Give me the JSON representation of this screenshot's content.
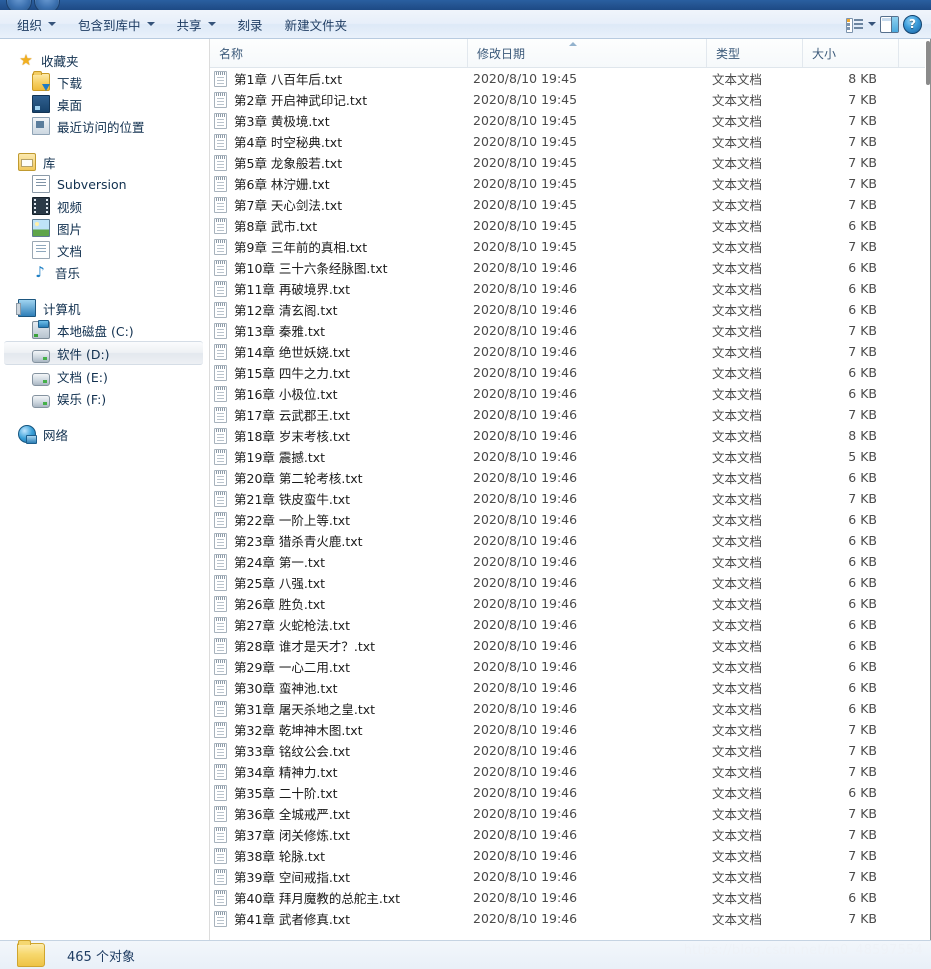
{
  "toolbar": {
    "items": [
      {
        "label": "组织",
        "caret": true,
        "name": "organize"
      },
      {
        "label": "包含到库中",
        "caret": true,
        "name": "include-in-library"
      },
      {
        "label": "共享",
        "caret": true,
        "name": "share-with"
      },
      {
        "label": "刻录",
        "caret": false,
        "name": "burn"
      },
      {
        "label": "新建文件夹",
        "caret": false,
        "name": "new-folder"
      }
    ],
    "right": {
      "views_icon": "views-icon",
      "views_caret_icon": "chevron-down-icon",
      "preview_pane_icon": "preview-pane-icon",
      "help_icon": "help-icon",
      "help_label": "?"
    }
  },
  "sidebar": {
    "groups": [
      {
        "header": {
          "label": "收藏夹",
          "icon": "star-icon",
          "name": "favorites"
        },
        "items": [
          {
            "label": "下载",
            "icon": "downloads-folder-icon",
            "name": "downloads"
          },
          {
            "label": "桌面",
            "icon": "desktop-icon",
            "name": "desktop"
          },
          {
            "label": "最近访问的位置",
            "icon": "recent-places-icon",
            "name": "recent-places"
          }
        ]
      },
      {
        "header": {
          "label": "库",
          "icon": "libraries-icon",
          "name": "libraries"
        },
        "items": [
          {
            "label": "Subversion",
            "icon": "document-icon",
            "name": "subversion"
          },
          {
            "label": "视频",
            "icon": "video-icon",
            "name": "videos"
          },
          {
            "label": "图片",
            "icon": "picture-icon",
            "name": "pictures"
          },
          {
            "label": "文档",
            "icon": "document-icon",
            "name": "documents"
          },
          {
            "label": "音乐",
            "icon": "music-note-icon",
            "name": "music"
          }
        ]
      },
      {
        "header": {
          "label": "计算机",
          "icon": "computer-icon",
          "name": "computer"
        },
        "items": [
          {
            "label": "本地磁盘 (C:)",
            "icon": "system-drive-icon",
            "name": "drive-c",
            "selected": false
          },
          {
            "label": "软件 (D:)",
            "icon": "drive-icon",
            "name": "drive-d",
            "selected": true
          },
          {
            "label": "文档 (E:)",
            "icon": "drive-icon",
            "name": "drive-e",
            "selected": false
          },
          {
            "label": "娱乐 (F:)",
            "icon": "drive-icon",
            "name": "drive-f",
            "selected": false
          }
        ]
      },
      {
        "header": {
          "label": "网络",
          "icon": "network-icon",
          "name": "network"
        },
        "items": []
      }
    ]
  },
  "columns": [
    {
      "label": "名称",
      "key": "name",
      "sorted": false
    },
    {
      "label": "修改日期",
      "key": "date",
      "sorted": true,
      "sort_direction": "asc"
    },
    {
      "label": "类型",
      "key": "type",
      "sorted": false
    },
    {
      "label": "大小",
      "key": "size",
      "sorted": false
    }
  ],
  "files": [
    {
      "name": "第1章 八百年后.txt",
      "date": "2020/8/10 19:45",
      "type": "文本文档",
      "size": "8 KB"
    },
    {
      "name": "第2章 开启神武印记.txt",
      "date": "2020/8/10 19:45",
      "type": "文本文档",
      "size": "7 KB"
    },
    {
      "name": "第3章 黄极境.txt",
      "date": "2020/8/10 19:45",
      "type": "文本文档",
      "size": "7 KB"
    },
    {
      "name": "第4章 时空秘典.txt",
      "date": "2020/8/10 19:45",
      "type": "文本文档",
      "size": "7 KB"
    },
    {
      "name": "第5章 龙象般若.txt",
      "date": "2020/8/10 19:45",
      "type": "文本文档",
      "size": "7 KB"
    },
    {
      "name": "第6章 林泞姗.txt",
      "date": "2020/8/10 19:45",
      "type": "文本文档",
      "size": "7 KB"
    },
    {
      "name": "第7章 天心剑法.txt",
      "date": "2020/8/10 19:45",
      "type": "文本文档",
      "size": "7 KB"
    },
    {
      "name": "第8章 武市.txt",
      "date": "2020/8/10 19:45",
      "type": "文本文档",
      "size": "6 KB"
    },
    {
      "name": "第9章 三年前的真相.txt",
      "date": "2020/8/10 19:45",
      "type": "文本文档",
      "size": "7 KB"
    },
    {
      "name": "第10章 三十六条经脉图.txt",
      "date": "2020/8/10 19:46",
      "type": "文本文档",
      "size": "6 KB"
    },
    {
      "name": "第11章 再破境界.txt",
      "date": "2020/8/10 19:46",
      "type": "文本文档",
      "size": "6 KB"
    },
    {
      "name": "第12章 清玄阁.txt",
      "date": "2020/8/10 19:46",
      "type": "文本文档",
      "size": "6 KB"
    },
    {
      "name": "第13章 秦雅.txt",
      "date": "2020/8/10 19:46",
      "type": "文本文档",
      "size": "7 KB"
    },
    {
      "name": "第14章 绝世妖娆.txt",
      "date": "2020/8/10 19:46",
      "type": "文本文档",
      "size": "7 KB"
    },
    {
      "name": "第15章 四牛之力.txt",
      "date": "2020/8/10 19:46",
      "type": "文本文档",
      "size": "6 KB"
    },
    {
      "name": "第16章 小极位.txt",
      "date": "2020/8/10 19:46",
      "type": "文本文档",
      "size": "6 KB"
    },
    {
      "name": "第17章 云武郡王.txt",
      "date": "2020/8/10 19:46",
      "type": "文本文档",
      "size": "7 KB"
    },
    {
      "name": "第18章 岁末考核.txt",
      "date": "2020/8/10 19:46",
      "type": "文本文档",
      "size": "8 KB"
    },
    {
      "name": "第19章 震撼.txt",
      "date": "2020/8/10 19:46",
      "type": "文本文档",
      "size": "5 KB"
    },
    {
      "name": "第20章 第二轮考核.txt",
      "date": "2020/8/10 19:46",
      "type": "文本文档",
      "size": "6 KB"
    },
    {
      "name": "第21章 铁皮蛮牛.txt",
      "date": "2020/8/10 19:46",
      "type": "文本文档",
      "size": "7 KB"
    },
    {
      "name": "第22章 一阶上等.txt",
      "date": "2020/8/10 19:46",
      "type": "文本文档",
      "size": "6 KB"
    },
    {
      "name": "第23章 猎杀青火鹿.txt",
      "date": "2020/8/10 19:46",
      "type": "文本文档",
      "size": "6 KB"
    },
    {
      "name": "第24章 第一.txt",
      "date": "2020/8/10 19:46",
      "type": "文本文档",
      "size": "6 KB"
    },
    {
      "name": "第25章 八强.txt",
      "date": "2020/8/10 19:46",
      "type": "文本文档",
      "size": "6 KB"
    },
    {
      "name": "第26章 胜负.txt",
      "date": "2020/8/10 19:46",
      "type": "文本文档",
      "size": "6 KB"
    },
    {
      "name": "第27章 火蛇枪法.txt",
      "date": "2020/8/10 19:46",
      "type": "文本文档",
      "size": "6 KB"
    },
    {
      "name": "第28章 谁才是天才？.txt",
      "date": "2020/8/10 19:46",
      "type": "文本文档",
      "size": "6 KB"
    },
    {
      "name": "第29章 一心二用.txt",
      "date": "2020/8/10 19:46",
      "type": "文本文档",
      "size": "6 KB"
    },
    {
      "name": "第30章 蛮神池.txt",
      "date": "2020/8/10 19:46",
      "type": "文本文档",
      "size": "6 KB"
    },
    {
      "name": "第31章 屠天杀地之皇.txt",
      "date": "2020/8/10 19:46",
      "type": "文本文档",
      "size": "6 KB"
    },
    {
      "name": "第32章 乾坤神木图.txt",
      "date": "2020/8/10 19:46",
      "type": "文本文档",
      "size": "7 KB"
    },
    {
      "name": "第33章 铭纹公会.txt",
      "date": "2020/8/10 19:46",
      "type": "文本文档",
      "size": "7 KB"
    },
    {
      "name": "第34章 精神力.txt",
      "date": "2020/8/10 19:46",
      "type": "文本文档",
      "size": "7 KB"
    },
    {
      "name": "第35章 二十阶.txt",
      "date": "2020/8/10 19:46",
      "type": "文本文档",
      "size": "6 KB"
    },
    {
      "name": "第36章 全城戒严.txt",
      "date": "2020/8/10 19:46",
      "type": "文本文档",
      "size": "7 KB"
    },
    {
      "name": "第37章 闭关修炼.txt",
      "date": "2020/8/10 19:46",
      "type": "文本文档",
      "size": "7 KB"
    },
    {
      "name": "第38章 轮脉.txt",
      "date": "2020/8/10 19:46",
      "type": "文本文档",
      "size": "7 KB"
    },
    {
      "name": "第39章 空间戒指.txt",
      "date": "2020/8/10 19:46",
      "type": "文本文档",
      "size": "7 KB"
    },
    {
      "name": "第40章 拜月魔教的总舵主.txt",
      "date": "2020/8/10 19:46",
      "type": "文本文档",
      "size": "6 KB"
    },
    {
      "name": "第41章 武者修真.txt",
      "date": "2020/8/10 19:46",
      "type": "文本文档",
      "size": "7 KB"
    }
  ],
  "status": {
    "icon": "folder-icon",
    "text": "465 个对象"
  },
  "watermark": "https://blog.csdn.net/m0_48597554"
}
